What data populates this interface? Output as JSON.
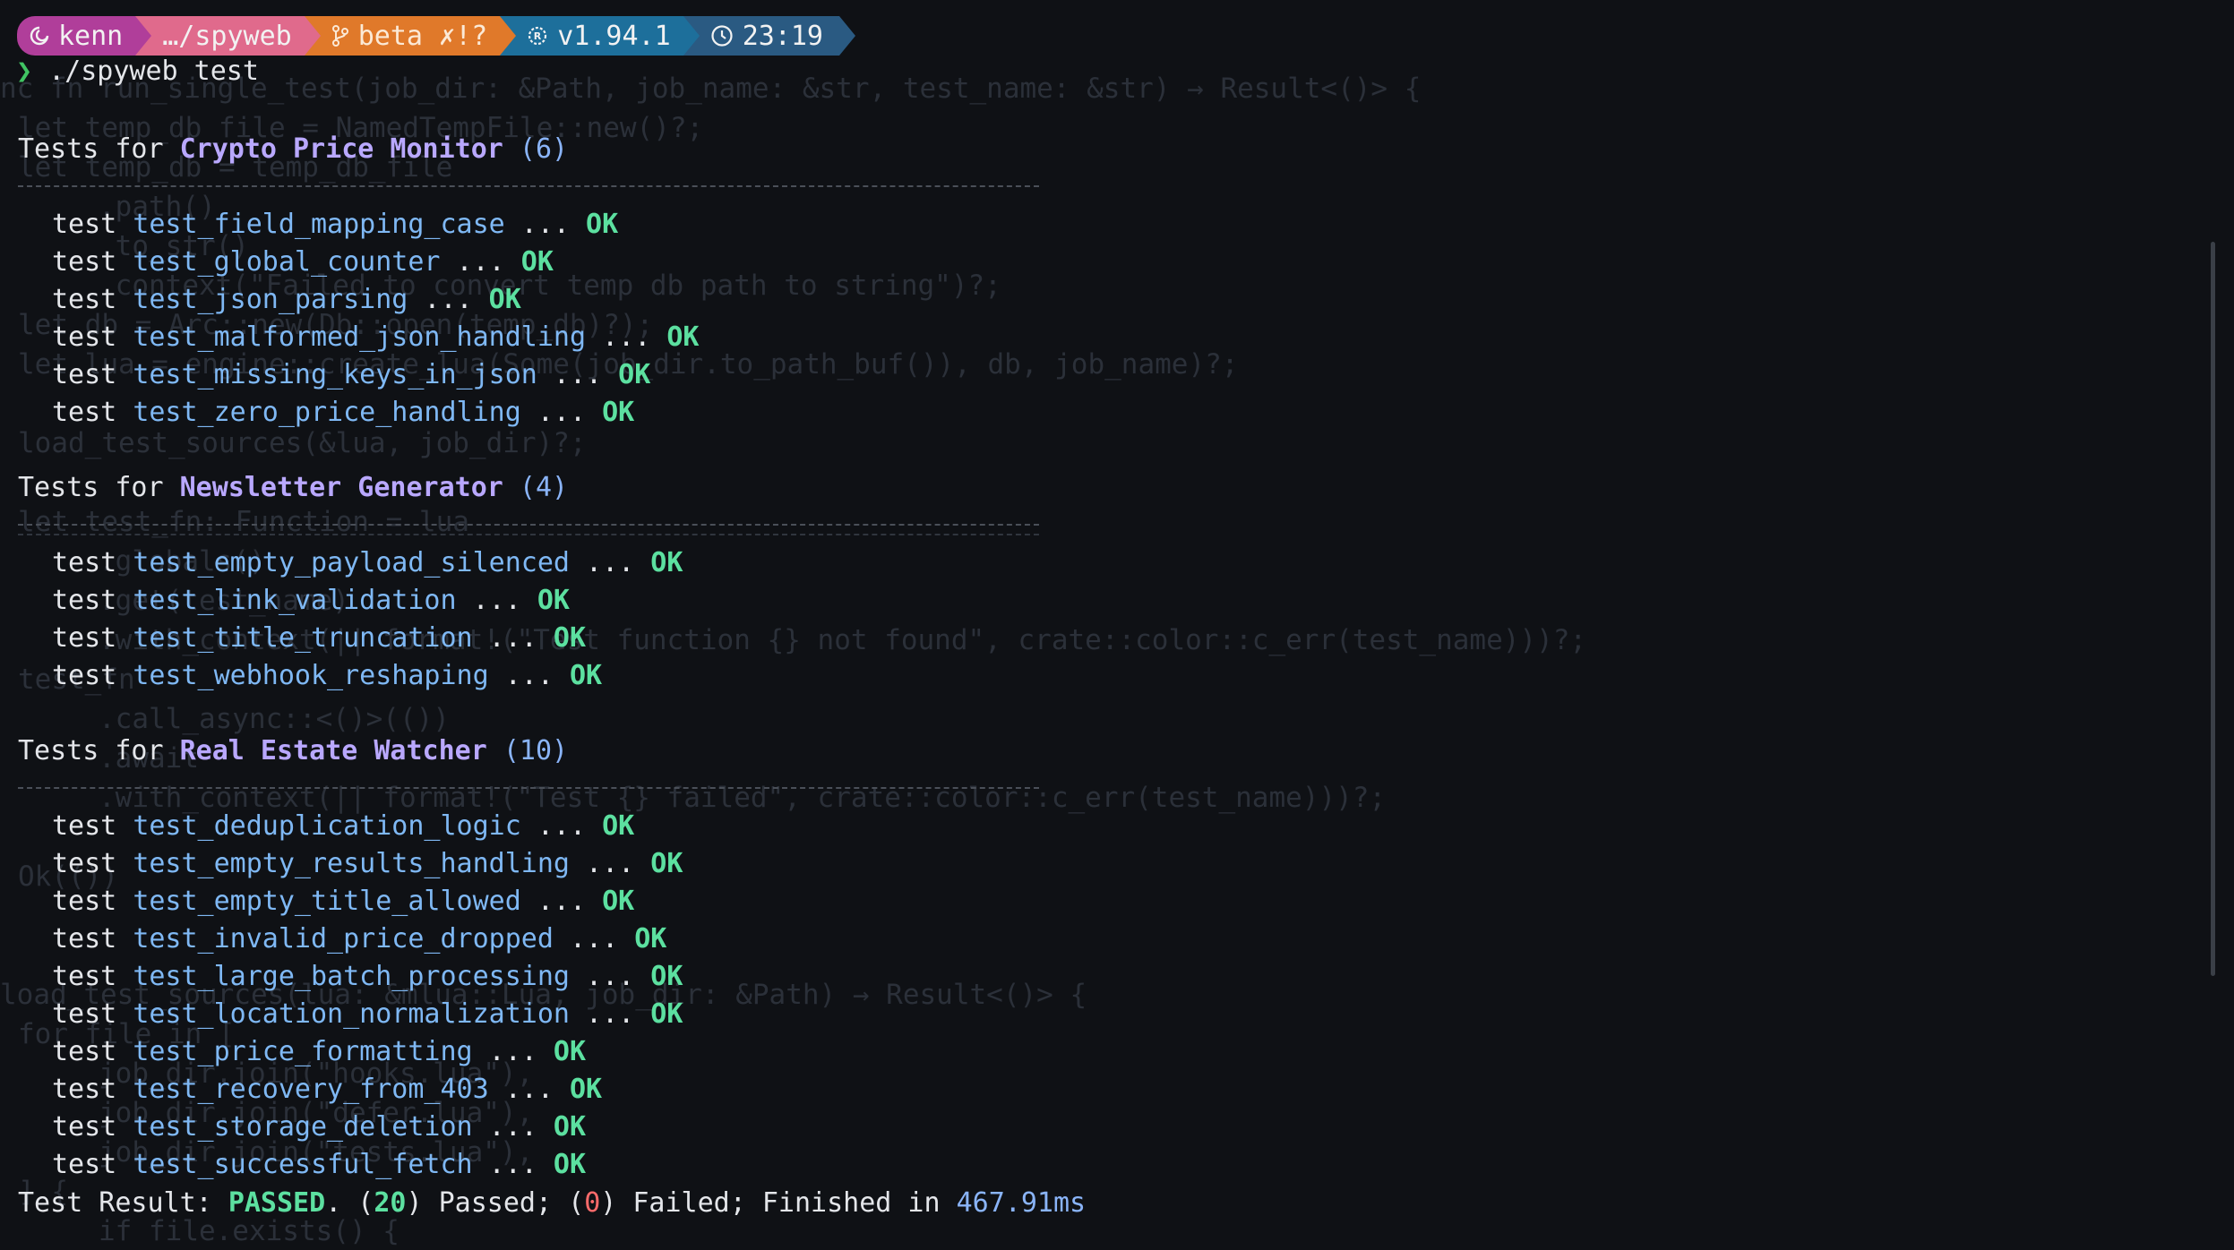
{
  "prompt": {
    "user": "kenn",
    "path": "…/spyweb",
    "branch": "beta",
    "git_status": "✗!?",
    "version": "v1.94.1",
    "time": "23:19"
  },
  "command": "./spyweb test",
  "suites": [
    {
      "prefix": "Tests for ",
      "name": "Crypto Price Monitor",
      "count": "(6)",
      "tests": [
        {
          "name": "test_field_mapping_case",
          "status": "OK"
        },
        {
          "name": "test_global_counter",
          "status": "OK"
        },
        {
          "name": "test_json_parsing",
          "status": "OK"
        },
        {
          "name": "test_malformed_json_handling",
          "status": "OK"
        },
        {
          "name": "test_missing_keys_in_json",
          "status": "OK"
        },
        {
          "name": "test_zero_price_handling",
          "status": "OK"
        }
      ]
    },
    {
      "prefix": "Tests for ",
      "name": "Newsletter Generator",
      "count": "(4)",
      "tests": [
        {
          "name": "test_empty_payload_silenced",
          "status": "OK"
        },
        {
          "name": "test_link_validation",
          "status": "OK"
        },
        {
          "name": "test_title_truncation",
          "status": "OK"
        },
        {
          "name": "test_webhook_reshaping",
          "status": "OK"
        }
      ]
    },
    {
      "prefix": "Tests for ",
      "name": "Real Estate Watcher",
      "count": "(10)",
      "tests": [
        {
          "name": "test_deduplication_logic",
          "status": "OK"
        },
        {
          "name": "test_empty_results_handling",
          "status": "OK"
        },
        {
          "name": "test_empty_title_allowed",
          "status": "OK"
        },
        {
          "name": "test_invalid_price_dropped",
          "status": "OK"
        },
        {
          "name": "test_large_batch_processing",
          "status": "OK"
        },
        {
          "name": "test_location_normalization",
          "status": "OK"
        },
        {
          "name": "test_price_formatting",
          "status": "OK"
        },
        {
          "name": "test_recovery_from_403",
          "status": "OK"
        },
        {
          "name": "test_storage_deletion",
          "status": "OK"
        },
        {
          "name": "test_successful_fetch",
          "status": "OK"
        }
      ]
    }
  ],
  "test_word": "test",
  "ellipsis": "...",
  "result": {
    "label": "Test Result: ",
    "status": "PASSED",
    "passed_count": "20",
    "passed_text": ") Passed; (",
    "failed_count": "0",
    "failed_text": ") Failed; Finished in ",
    "duration": "467.91ms"
  },
  "background_code": [
    "nc fn run_single_test(job_dir: &Path, job_name: &str, test_name: &str) → Result<()> {",
    "  let temp_db_file = NamedTempFile::new()?;",
    "  let temp_db = temp_db_file",
    "      .path()",
    "      .to_str()",
    "      .context(\"Failed to convert temp db path to string\")?;",
    "  let db = Arc::new(Db::open(temp_db)?);",
    "  let lua = engine::create_lua(Some(job_dir.to_path_buf()), db, job_name)?;",
    "  load_test_sources(&lua, job_dir)?;",
    "  let test_fn: Function = lua",
    "      .globals()",
    "      .get(test_name)",
    "      .with_context(|| format!(\"Test function {} not found\", crate::color::c_err(test_name)))?;",
    "  test_fn",
    "      .call_async::<()>(())",
    "      .await",
    "      .with_context(|| format!(\"Test {} failed\", crate::color::c_err(test_name)))?;",
    "  Ok(())",
    "load_test_sources(lua: &mlua::Lua, job_dir: &Path) → Result<()> {",
    "  for file in [",
    "      job_dir.join(\"hooks.lua\"),",
    "      job_dir.join(\"defer.lua\"),",
    "      job_dir.join(\"tests.lua\"),",
    "  ] {",
    "      if file.exists() {"
  ],
  "colors": {
    "ok": "#5ce0a0",
    "suite_name": "#b9a8ff",
    "test_name": "#7fb8f4",
    "failed_count": "#ff6b6b",
    "background": "#0f1115"
  }
}
